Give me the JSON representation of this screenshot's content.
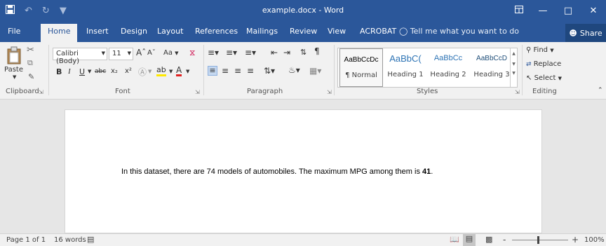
{
  "titlebar": {
    "title": "example.docx - Word",
    "icons": [
      "save-icon",
      "undo-icon",
      "redo-icon",
      "customize-qat-icon",
      "ribbon-display-options-icon",
      "minimize-icon",
      "maximize-icon",
      "close-icon"
    ]
  },
  "tabs": [
    "File",
    "Home",
    "Insert",
    "Design",
    "Layout",
    "References",
    "Mailings",
    "Review",
    "View",
    "ACROBAT"
  ],
  "active_tab": "Home",
  "tell_me": "Tell me what you want to do",
  "share_label": "Share",
  "clipboard": {
    "paste_label": "Paste",
    "group_label": "Clipboard"
  },
  "font": {
    "name": "Calibri (Body)",
    "size": "11",
    "case_label": "Aa",
    "group_label": "Font",
    "bold": "B",
    "italic": "I",
    "underline": "U",
    "strike": "abc",
    "subscript": "x₂",
    "superscript": "x²"
  },
  "paragraph": {
    "group_label": "Paragraph",
    "pilcrow": "¶"
  },
  "styles": {
    "group_label": "Styles",
    "items": [
      {
        "preview": "AaBbCcDc",
        "name": "¶ Normal"
      },
      {
        "preview": "AaBbC(",
        "name": "Heading 1"
      },
      {
        "preview": "AaBbCc",
        "name": "Heading 2"
      },
      {
        "preview": "AaBbCcD",
        "name": "Heading 3"
      }
    ]
  },
  "editing": {
    "find": "Find",
    "replace": "Replace",
    "select": "Select",
    "group_label": "Editing"
  },
  "document": {
    "text_before": "In this dataset, there are 74 models of automobiles. The maximum MPG among them is ",
    "text_bold": "41",
    "text_after": "."
  },
  "status": {
    "page": "Page 1 of 1",
    "words": "16 words",
    "zoom": "100%",
    "zoom_minus": "-",
    "zoom_plus": "+"
  },
  "colors": {
    "accent": "#2b579a",
    "ribbon_bg": "#f1f1f1",
    "doc_bg": "#e6e6e6"
  }
}
